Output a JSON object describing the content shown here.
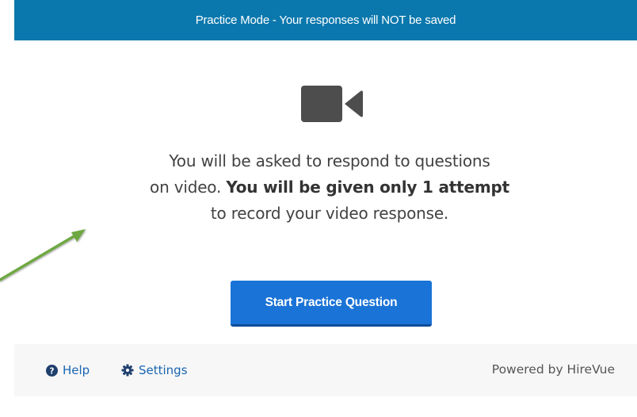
{
  "banner": {
    "text": "Practice Mode - Your responses will NOT be saved"
  },
  "icons": {
    "camera": "video-camera-icon",
    "help": "question-circle-icon",
    "settings": "gear-icon",
    "arrow": "green-arrow-annotation"
  },
  "intro": {
    "line1": "You will be asked to respond to questions",
    "line2_start": "on video. ",
    "line2_bold": "You will be given only 1 attempt",
    "line3": "to record your video response."
  },
  "start_button": {
    "label": "Start Practice Question"
  },
  "footer": {
    "help_label": "Help",
    "settings_label": "Settings",
    "powered_by": "Powered by HireVue"
  },
  "colors": {
    "banner": "#0b78ad",
    "button": "#1a73d6",
    "link": "#1a66b3",
    "arrow": "#6ea842"
  }
}
